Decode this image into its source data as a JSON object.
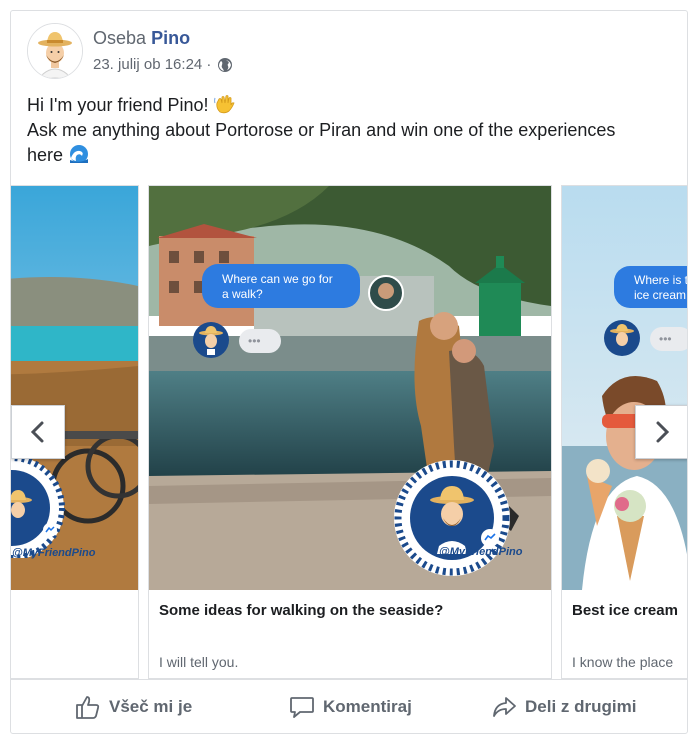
{
  "post": {
    "author_prefix": "Oseba",
    "author_name": "Pino",
    "timestamp": "23. julij ob 16:24 ·",
    "privacy_icon": "globe-icon",
    "message_line1": "Hi I'm your friend Pino!",
    "message_line2": "Ask me anything about Portorose or Piran and win one of the experiences",
    "message_line3": "here"
  },
  "carousel": {
    "cards": [
      {
        "title": "",
        "description": "",
        "chat_tag": "@MyFriendPino"
      },
      {
        "title": "Some ideas for walking on the seaside?",
        "description": "I will tell you.",
        "chat_question": "Where can we go for a walk?",
        "chat_question_line1": "Where can we go for",
        "chat_question_line2": "a walk?",
        "chat_tag": "@MyFriendPino"
      },
      {
        "title": "Best ice cream",
        "description": "I know the place",
        "chat_question_line1": "Where is t",
        "chat_question_line2": "ice cream"
      }
    ],
    "typing_dots": "•••",
    "prev_icon": "chevron-left-icon",
    "next_icon": "chevron-right-icon"
  },
  "actions": {
    "like": "Všeč mi je",
    "comment": "Komentiraj",
    "share": "Deli z drugimi"
  },
  "colors": {
    "link_blue": "#385898",
    "bubble_blue": "#2d7be0",
    "muted_text": "#606770",
    "border": "#dddfe2"
  }
}
